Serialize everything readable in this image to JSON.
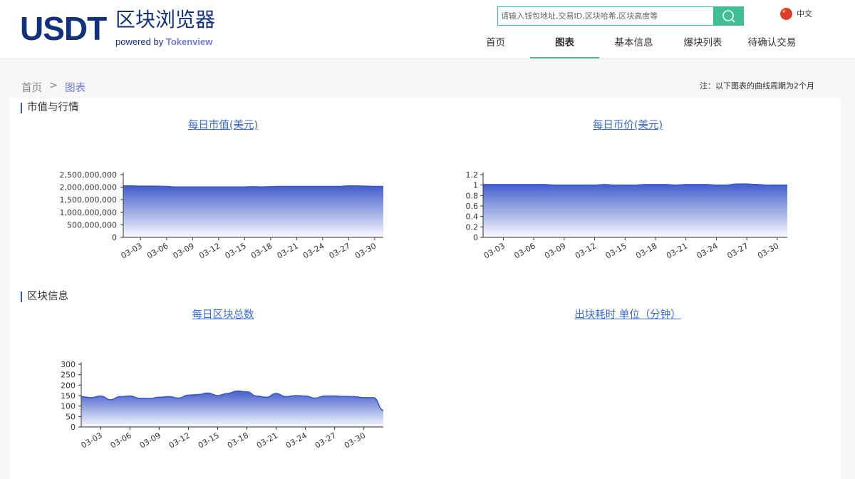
{
  "header": {
    "logo_main": "USDT",
    "logo_cn": "区块浏览器",
    "logo_powered": "powered by",
    "logo_brand": "Tokenview",
    "search_placeholder": "请输入钱包地址,交易ID,区块哈希,区块高度等",
    "lang_label": "中文",
    "nav": [
      {
        "label": "首页",
        "active": false
      },
      {
        "label": "图表",
        "active": true
      },
      {
        "label": "基本信息",
        "active": false
      },
      {
        "label": "爆块列表",
        "active": false
      },
      {
        "label": "待确认交易",
        "active": false
      }
    ],
    "icons": {
      "search": "search-icon",
      "flag": "china-flag-icon"
    },
    "accent_color": "#3fbf95",
    "brand_color": "#13307a"
  },
  "breadcrumb": {
    "home": "首页",
    "separator": ">",
    "current": "图表"
  },
  "note": "注：以下图表的曲线周期为2个月",
  "sections": {
    "market": "市值与行情",
    "block": "区块信息"
  },
  "chart_titles": {
    "market_cap": "每日市值(美元)",
    "price": "每日币价(美元)",
    "block_count": "每日区块总数",
    "block_time": "出块耗时 单位（分钟）"
  },
  "chart_data": [
    {
      "id": "market_cap",
      "type": "area",
      "title": "每日市值(美元)",
      "x": [
        "03-01",
        "03-02",
        "03-03",
        "03-04",
        "03-05",
        "03-06",
        "03-07",
        "03-08",
        "03-09",
        "03-10",
        "03-11",
        "03-12",
        "03-13",
        "03-14",
        "03-15",
        "03-16",
        "03-17",
        "03-18",
        "03-19",
        "03-20",
        "03-21",
        "03-22",
        "03-23",
        "03-24",
        "03-25",
        "03-26",
        "03-27",
        "03-28",
        "03-29",
        "03-30",
        "03-31"
      ],
      "values": [
        2050000000,
        2050000000,
        2040000000,
        2040000000,
        2040000000,
        2030000000,
        2010000000,
        2010000000,
        2010000000,
        2010000000,
        2010000000,
        2010000000,
        2010000000,
        2010000000,
        2010000000,
        2020000000,
        2010000000,
        2020000000,
        2030000000,
        2030000000,
        2030000000,
        2030000000,
        2030000000,
        2030000000,
        2030000000,
        2030000000,
        2050000000,
        2050000000,
        2040000000,
        2030000000,
        2030000000
      ],
      "xticks": [
        "03-03",
        "03-06",
        "03-09",
        "03-12",
        "03-15",
        "03-18",
        "03-21",
        "03-24",
        "03-27",
        "03-30"
      ],
      "yticks": [
        "0",
        "500,000,000",
        "1,000,000,000",
        "1,500,000,000",
        "2,000,000,000",
        "2,500,000,000"
      ],
      "ylim": [
        0,
        2500000000
      ],
      "color": "#3a56c8"
    },
    {
      "id": "price",
      "type": "area",
      "title": "每日币价(美元)",
      "x": [
        "03-01",
        "03-02",
        "03-03",
        "03-04",
        "03-05",
        "03-06",
        "03-07",
        "03-08",
        "03-09",
        "03-10",
        "03-11",
        "03-12",
        "03-13",
        "03-14",
        "03-15",
        "03-16",
        "03-17",
        "03-18",
        "03-19",
        "03-20",
        "03-21",
        "03-22",
        "03-23",
        "03-24",
        "03-25",
        "03-26",
        "03-27",
        "03-28",
        "03-29",
        "03-30",
        "03-31"
      ],
      "values": [
        1.01,
        1.01,
        1.01,
        1.01,
        1.01,
        1.01,
        1.01,
        1.0,
        1.0,
        1.0,
        1.0,
        1.0,
        1.01,
        1.0,
        1.0,
        1.0,
        1.01,
        1.01,
        1.01,
        1.0,
        1.01,
        1.01,
        1.01,
        1.0,
        1.0,
        1.02,
        1.02,
        1.01,
        1.0,
        1.0,
        1.0
      ],
      "xticks": [
        "03-03",
        "03-06",
        "03-09",
        "03-12",
        "03-15",
        "03-18",
        "03-21",
        "03-24",
        "03-27",
        "03-30"
      ],
      "yticks": [
        "0",
        "0.2",
        "0.4",
        "0.6",
        "0.8",
        "1",
        "1.2"
      ],
      "ylim": [
        0,
        1.2
      ],
      "color": "#3a56c8"
    },
    {
      "id": "block_count",
      "type": "area",
      "title": "每日区块总数",
      "x": [
        "03-01",
        "03-02",
        "03-03",
        "03-04",
        "03-05",
        "03-06",
        "03-07",
        "03-08",
        "03-09",
        "03-10",
        "03-11",
        "03-12",
        "03-13",
        "03-14",
        "03-15",
        "03-16",
        "03-17",
        "03-18",
        "03-19",
        "03-20",
        "03-21",
        "03-22",
        "03-23",
        "03-24",
        "03-25",
        "03-26",
        "03-27",
        "03-28",
        "03-29",
        "03-30",
        "03-31",
        "04-01"
      ],
      "values": [
        145,
        140,
        148,
        130,
        145,
        148,
        137,
        136,
        142,
        145,
        138,
        152,
        155,
        162,
        150,
        160,
        172,
        168,
        148,
        142,
        160,
        145,
        150,
        148,
        138,
        148,
        148,
        146,
        145,
        140,
        140,
        80
      ],
      "xticks": [
        "03-03",
        "03-06",
        "03-09",
        "03-12",
        "03-15",
        "03-18",
        "03-21",
        "03-24",
        "03-27",
        "03-30"
      ],
      "yticks": [
        "0",
        "50",
        "100",
        "150",
        "200",
        "250",
        "300"
      ],
      "ylim": [
        0,
        300
      ],
      "color": "#3a56c8"
    }
  ]
}
